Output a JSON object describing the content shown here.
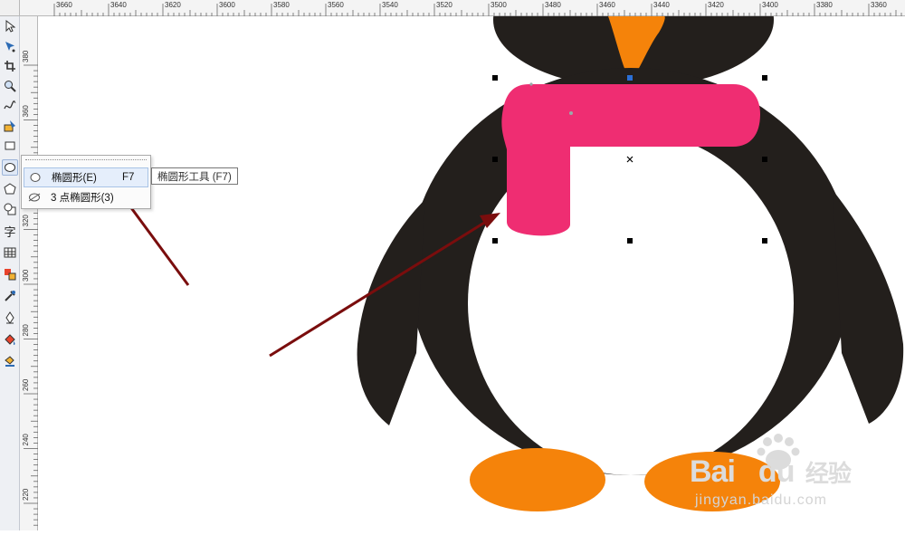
{
  "ruler_top": {
    "ticks": [
      "3660",
      "3640",
      "3620",
      "3600",
      "3580",
      "3560",
      "3540",
      "3520",
      "3500",
      "3480",
      "3460",
      "3440",
      "3420",
      "3400",
      "3380",
      "3360"
    ]
  },
  "ruler_left": {
    "ticks": [
      "380",
      "360",
      "340",
      "320",
      "300",
      "280",
      "260",
      "240",
      "220"
    ]
  },
  "toolbox": {
    "tools": [
      {
        "name": "pick-tool-icon"
      },
      {
        "name": "shape-tool-icon"
      },
      {
        "name": "crop-tool-icon"
      },
      {
        "name": "zoom-tool-icon"
      },
      {
        "name": "freehand-tool-icon"
      },
      {
        "name": "smart-fill-tool-icon"
      },
      {
        "name": "rectangle-tool-icon"
      },
      {
        "name": "ellipse-tool-icon"
      },
      {
        "name": "polygon-tool-icon"
      },
      {
        "name": "basic-shapes-tool-icon"
      },
      {
        "name": "text-tool-icon",
        "glyph": "字"
      },
      {
        "name": "table-tool-icon"
      },
      {
        "name": "interactive-blend-tool-icon"
      },
      {
        "name": "eyedropper-tool-icon"
      },
      {
        "name": "outline-pen-tool-icon"
      },
      {
        "name": "fill-tool-icon"
      },
      {
        "name": "smart-fill-alt-tool-icon"
      }
    ]
  },
  "flyout": {
    "items": [
      {
        "label": "椭圆形(E)",
        "shortcut": "F7",
        "icon": "ellipse-icon"
      },
      {
        "label": "3 点椭圆形(3)",
        "shortcut": "",
        "icon": "three-point-ellipse-icon"
      }
    ]
  },
  "tooltip": {
    "text": "椭圆形工具 (F7)"
  },
  "watermark": {
    "brand_left": "Bai",
    "brand_right": "du",
    "suffix": "经验",
    "url": "jingyan.baidu.com"
  },
  "colors": {
    "penguin_body": "#231f1c",
    "belly": "#ffffff",
    "beak_feet": "#f5830a",
    "scarf": "#ef2d72",
    "arrow": "#7a0d0d",
    "handle": "#000000"
  }
}
